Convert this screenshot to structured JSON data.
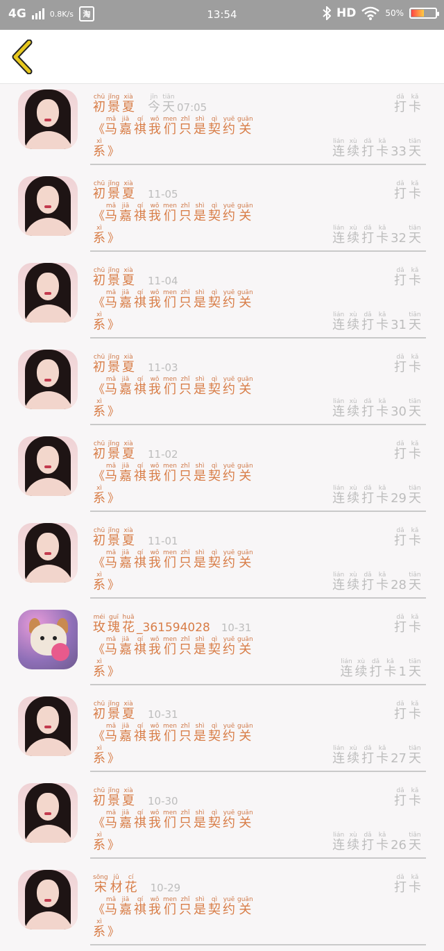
{
  "status_bar": {
    "network": "4G",
    "speed": "0.8K/s",
    "app_chip": "淘",
    "time": "13:54",
    "hd": "HD",
    "battery": "50%"
  },
  "nav": {
    "back_icon": "chevron-left-icon",
    "accent": "#e7c81f"
  },
  "rows": [
    {
      "avatar": "girl",
      "name_py": [
        "chū",
        "jǐng",
        "xià"
      ],
      "name_hz": [
        "初",
        "景",
        "夏"
      ],
      "name_suffix": "",
      "date_py": [
        "jīn",
        "tiān"
      ],
      "date_hz": [
        "今",
        "天"
      ],
      "date": "07:05",
      "streak": "33"
    },
    {
      "avatar": "girl",
      "name_py": [
        "chū",
        "jǐng",
        "xià"
      ],
      "name_hz": [
        "初",
        "景",
        "夏"
      ],
      "name_suffix": "",
      "date_py": [],
      "date_hz": [],
      "date": "11-05",
      "streak": "32"
    },
    {
      "avatar": "girl",
      "name_py": [
        "chū",
        "jǐng",
        "xià"
      ],
      "name_hz": [
        "初",
        "景",
        "夏"
      ],
      "name_suffix": "",
      "date_py": [],
      "date_hz": [],
      "date": "11-04",
      "streak": "31"
    },
    {
      "avatar": "girl",
      "name_py": [
        "chū",
        "jǐng",
        "xià"
      ],
      "name_hz": [
        "初",
        "景",
        "夏"
      ],
      "name_suffix": "",
      "date_py": [],
      "date_hz": [],
      "date": "11-03",
      "streak": "30"
    },
    {
      "avatar": "girl",
      "name_py": [
        "chū",
        "jǐng",
        "xià"
      ],
      "name_hz": [
        "初",
        "景",
        "夏"
      ],
      "name_suffix": "",
      "date_py": [],
      "date_hz": [],
      "date": "11-02",
      "streak": "29"
    },
    {
      "avatar": "girl",
      "name_py": [
        "chū",
        "jǐng",
        "xià"
      ],
      "name_hz": [
        "初",
        "景",
        "夏"
      ],
      "name_suffix": "",
      "date_py": [],
      "date_hz": [],
      "date": "11-01",
      "streak": "28"
    },
    {
      "avatar": "dog",
      "name_py": [
        "méi",
        "guī",
        "huā"
      ],
      "name_hz": [
        "玫",
        "瑰",
        "花"
      ],
      "name_suffix": "_361594028",
      "date_py": [],
      "date_hz": [],
      "date": "10-31",
      "streak": "1"
    },
    {
      "avatar": "girl",
      "name_py": [
        "chū",
        "jǐng",
        "xià"
      ],
      "name_hz": [
        "初",
        "景",
        "夏"
      ],
      "name_suffix": "",
      "date_py": [],
      "date_hz": [],
      "date": "10-31",
      "streak": "27"
    },
    {
      "avatar": "girl",
      "name_py": [
        "chū",
        "jǐng",
        "xià"
      ],
      "name_hz": [
        "初",
        "景",
        "夏"
      ],
      "name_suffix": "",
      "date_py": [],
      "date_hz": [],
      "date": "10-30",
      "streak": "26"
    },
    {
      "avatar": "girl",
      "name_py": [
        "sōng",
        "jǔ",
        "cí"
      ],
      "name_hz": [
        "宋",
        "材",
        "花"
      ],
      "name_suffix": "",
      "date_py": [],
      "date_hz": [],
      "date": "10-29",
      "streak": ""
    }
  ],
  "common": {
    "bracket_open": "《",
    "bracket_close": "》",
    "title_py": [
      "mǎ",
      "jiā",
      "qí",
      "wǒ",
      "men",
      "zhǐ",
      "shì",
      "qì",
      "yuē",
      "guān"
    ],
    "title_hz": [
      "马",
      "嘉",
      "祺",
      "我",
      "们",
      "只",
      "是",
      "契",
      "约",
      "关"
    ],
    "title2_py": [
      "xì"
    ],
    "title2_hz": [
      "系"
    ],
    "punch_py": [
      "dǎ",
      "kǎ"
    ],
    "punch_hz": [
      "打",
      "卡"
    ],
    "streak_pre_py": [
      "lián",
      "xù",
      "dǎ",
      "kǎ"
    ],
    "streak_pre_hz": [
      "连",
      "续",
      "打",
      "卡"
    ],
    "streak_post_py": [
      "tiān"
    ],
    "streak_post_hz": [
      "天"
    ]
  }
}
